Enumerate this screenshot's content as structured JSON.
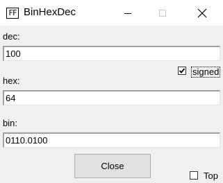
{
  "window": {
    "title": "BinHexDec",
    "icon_text": "FF",
    "icon": "app-ff-icon",
    "controls": [
      "minimize-icon",
      "maximize-icon",
      "close-icon"
    ]
  },
  "dec": {
    "label": "dec:",
    "value": "100"
  },
  "signed": {
    "label": "signed",
    "checked": true
  },
  "hex": {
    "label": "hex:",
    "value": "64"
  },
  "bin": {
    "label": "bin:",
    "value": "0110.0100"
  },
  "close_button": {
    "label": "Close"
  },
  "top": {
    "label": "Top",
    "checked": false
  },
  "colors": {
    "window_bg": "#f0f0f0",
    "titlebar_bg": "#ffffff",
    "field_bg": "#ffffff",
    "button_bg": "#e1e1e1"
  }
}
